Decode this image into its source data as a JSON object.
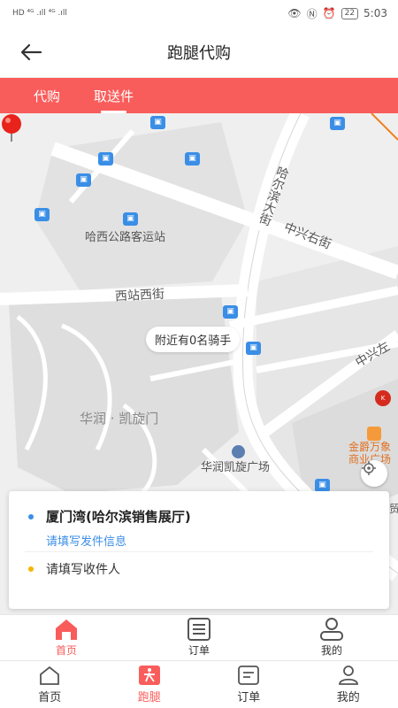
{
  "statusbar": {
    "left": "HD ⁴ᴳ .ıll ⁴ᴳ .ıll",
    "battery": "22",
    "time": "5:03"
  },
  "header": {
    "title": "跑腿代购"
  },
  "tabs": [
    {
      "label": "代购"
    },
    {
      "label": "取送件"
    }
  ],
  "map": {
    "labels": {
      "harbin_street": "哈尔滨大街",
      "zhongxing_right": "中兴右街",
      "station_west": "西站西街",
      "bus_station": "哈西公路客运站",
      "kaixuanmen": "华润 · 凯旋门",
      "plaza": "华润凯旋广场",
      "zhongxing_left": "中兴左",
      "mall": "金爵万象\n商业广场",
      "mao": "贸"
    },
    "riders_text": "附近有0名骑手"
  },
  "card": {
    "sender_name": "厦门湾(哈尔滨销售展厅)",
    "sender_info": "请填写发件信息",
    "receiver": "请填写收件人"
  },
  "nav_primary": [
    {
      "label": "首页",
      "icon": "home-icon"
    },
    {
      "label": "订单",
      "icon": "order-icon"
    },
    {
      "label": "我的",
      "icon": "user-icon"
    }
  ],
  "nav_secondary": [
    {
      "label": "首页",
      "icon": "home-icon"
    },
    {
      "label": "跑腿",
      "icon": "errand-icon"
    },
    {
      "label": "订单",
      "icon": "order-icon"
    },
    {
      "label": "我的",
      "icon": "user-icon"
    }
  ],
  "colors": {
    "accent": "#f95d5b",
    "link": "#3a8ee6",
    "receiver_dot": "#f5b400"
  }
}
